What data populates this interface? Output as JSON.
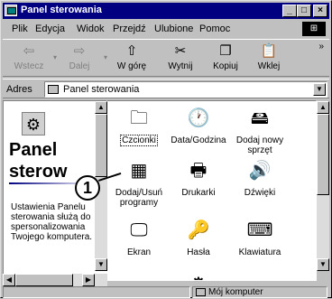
{
  "window": {
    "title": "Panel sterowania"
  },
  "menu": [
    {
      "label": "Plik"
    },
    {
      "label": "Edycja"
    },
    {
      "label": "Widok"
    },
    {
      "label": "Przejdź"
    },
    {
      "label": "Ulubione"
    },
    {
      "label": "Pomoc"
    }
  ],
  "toolbar": {
    "back": "Wstecz",
    "forward": "Dalej",
    "up": "W górę",
    "cut": "Wytnij",
    "copy": "Kopiuj",
    "paste": "Wklej",
    "more": "»"
  },
  "address": {
    "label": "Adres",
    "value": "Panel sterowania"
  },
  "left": {
    "heading_line1": "Panel",
    "heading_line2": "sterow",
    "description": "Ustawienia Panelu sterowania służą do spersonalizowania Twojego komputera."
  },
  "items": [
    {
      "label": "Czcionki",
      "icon": "fonts-folder-icon"
    },
    {
      "label": "Data/Godzina",
      "icon": "clock-icon"
    },
    {
      "label": "Dodaj nowy sprzęt",
      "icon": "hardware-icon"
    },
    {
      "label": "Dodaj/Usuń programy",
      "icon": "programs-icon"
    },
    {
      "label": "Drukarki",
      "icon": "printer-folder-icon"
    },
    {
      "label": "Dźwięki",
      "icon": "speaker-icon"
    },
    {
      "label": "Ekran",
      "icon": "monitor-icon"
    },
    {
      "label": "Hasła",
      "icon": "keys-icon"
    },
    {
      "label": "Klawiatura",
      "icon": "keyboard-icon"
    }
  ],
  "callout": {
    "number": "1"
  },
  "status": {
    "text": "Mój komputer"
  }
}
